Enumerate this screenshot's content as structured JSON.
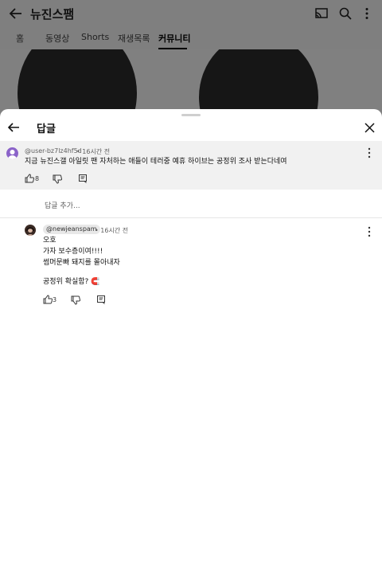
{
  "appbar": {
    "title": "뉴진스팸"
  },
  "tabs": [
    {
      "label": "홈"
    },
    {
      "label": "동영상"
    },
    {
      "label": "Shorts"
    },
    {
      "label": "재생목록"
    },
    {
      "label": "커뮤니티"
    }
  ],
  "sheet": {
    "title": "답글"
  },
  "parent_comment": {
    "author": "@user-bz7lz4hf5d",
    "time": "• 16시간 전",
    "text": "지금 뉴진스갤 아일릿 팬 자처하는 애들이 테러중 예휴 하이브는 공정위 조사 받는다네여",
    "likes": "8"
  },
  "add_reply_placeholder": "답글 추가...",
  "reply": {
    "author": "@newjeanspam",
    "time": "• 16시간 전",
    "lines": [
      "오호",
      "가자 보수층이여!!!!",
      "썸머문빠 돼지를 몰아내자",
      "",
      "공정위 확실함? 🧲"
    ],
    "likes": "3"
  },
  "colors": {
    "overlay_gray": "#7f7f7f",
    "parent_bg": "#f1f1f1",
    "avatar_purple": "#8b63c9"
  }
}
